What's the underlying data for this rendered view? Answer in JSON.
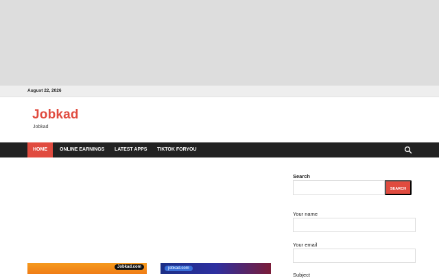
{
  "topbar": {
    "date": "August 22, 2026"
  },
  "site": {
    "title": "Jobkad",
    "description": "Jobkad"
  },
  "nav": {
    "items": [
      {
        "label": "HOME",
        "active": true
      },
      {
        "label": "ONLINE EARNINGS",
        "active": false
      },
      {
        "label": "LATEST APPS",
        "active": false
      },
      {
        "label": "TIKTOK FORYOU",
        "active": false
      }
    ],
    "search_icon": "search-icon"
  },
  "posts": [
    {
      "tag": "Jobkad.com"
    },
    {
      "tag": "jobkad.com"
    }
  ],
  "sidebar": {
    "search_title": "Search",
    "search_button": "SEARCH",
    "name_label": "Your name",
    "email_label": "Your email",
    "subject_label": "Subject"
  },
  "colors": {
    "accent": "#e04b3f",
    "nav_bg": "#222222",
    "topbar_bg": "#eeeeee",
    "ad_bg": "#dddddd"
  }
}
